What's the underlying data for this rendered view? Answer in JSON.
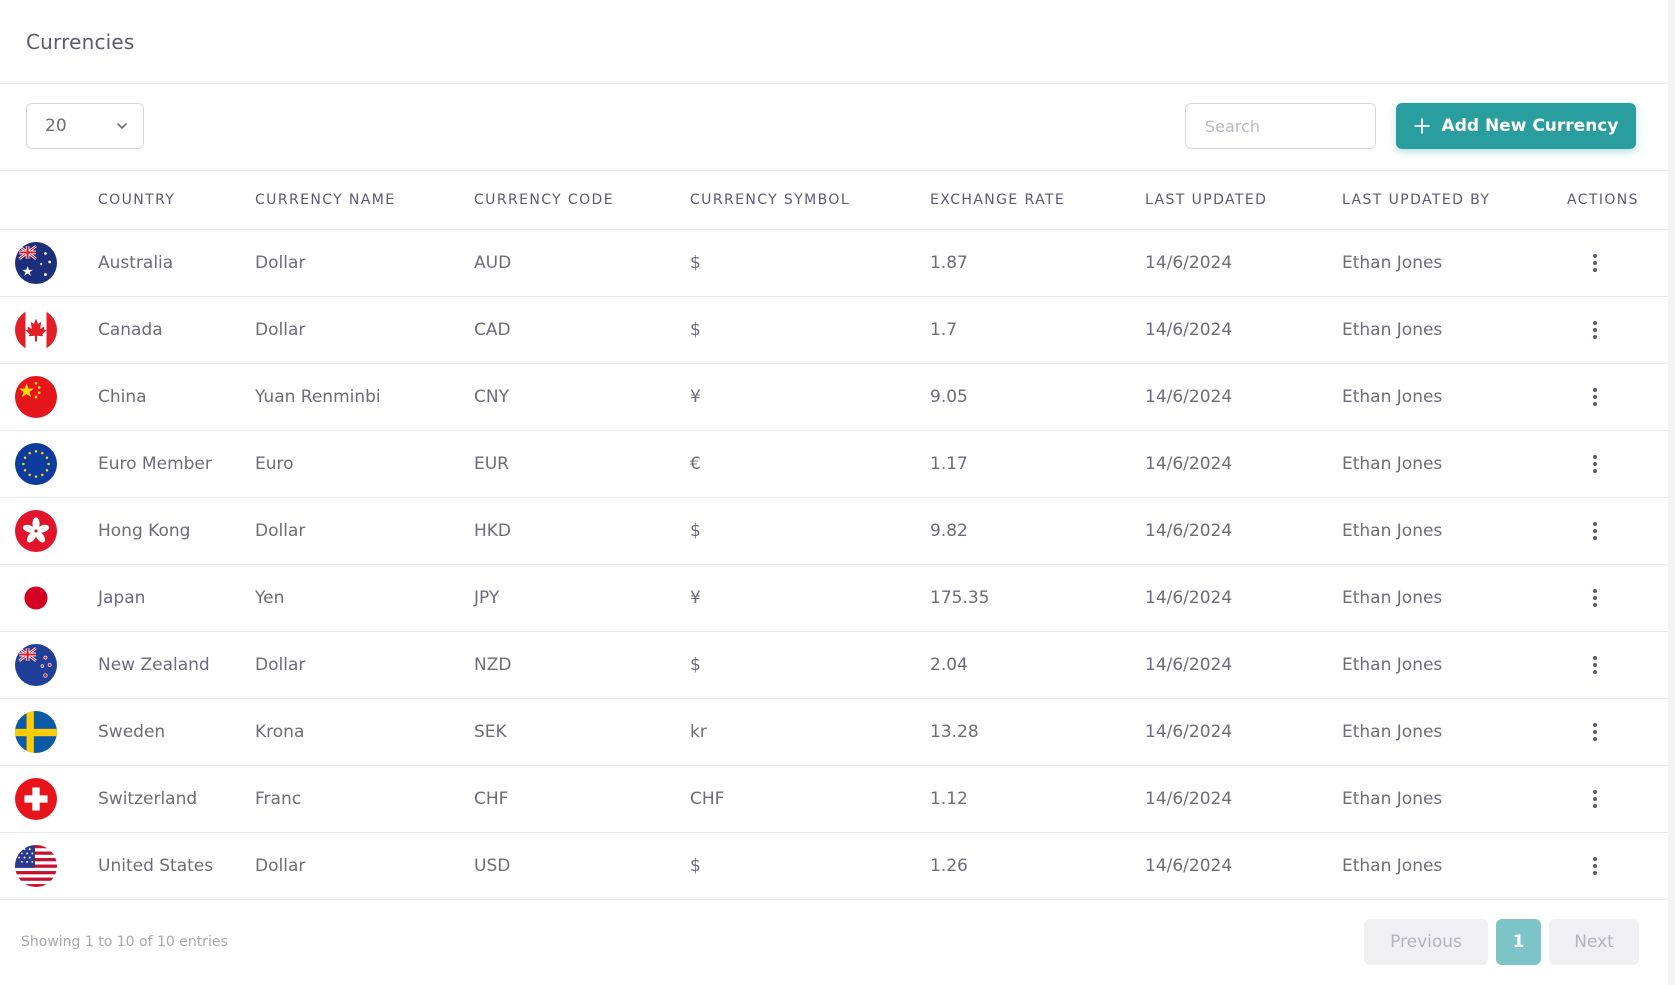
{
  "header": {
    "title": "Currencies"
  },
  "toolbar": {
    "page_length": "20",
    "search_placeholder": "Search",
    "add_label": "Add New Currency"
  },
  "columns": [
    "COUNTRY",
    "CURRENCY NAME",
    "CURRENCY CODE",
    "CURRENCY SYMBOL",
    "EXCHANGE RATE",
    "LAST UPDATED",
    "LAST UPDATED BY",
    "ACTIONS"
  ],
  "rows": [
    {
      "flag": "australia-flag-icon",
      "country": "Australia",
      "name": "Dollar",
      "code": "AUD",
      "symbol": "$",
      "rate": "1.87",
      "updated": "14/6/2024",
      "by": "Ethan Jones"
    },
    {
      "flag": "canada-flag-icon",
      "country": "Canada",
      "name": "Dollar",
      "code": "CAD",
      "symbol": "$",
      "rate": "1.7",
      "updated": "14/6/2024",
      "by": "Ethan Jones"
    },
    {
      "flag": "china-flag-icon",
      "country": "China",
      "name": "Yuan Renminbi",
      "code": "CNY",
      "symbol": "¥",
      "rate": "9.05",
      "updated": "14/6/2024",
      "by": "Ethan Jones"
    },
    {
      "flag": "eu-flag-icon",
      "country": "Euro Member",
      "name": "Euro",
      "code": "EUR",
      "symbol": "€",
      "rate": "1.17",
      "updated": "14/6/2024",
      "by": "Ethan Jones"
    },
    {
      "flag": "hong-kong-flag-icon",
      "country": "Hong Kong",
      "name": "Dollar",
      "code": "HKD",
      "symbol": "$",
      "rate": "9.82",
      "updated": "14/6/2024",
      "by": "Ethan Jones"
    },
    {
      "flag": "japan-flag-icon",
      "country": "Japan",
      "name": "Yen",
      "code": "JPY",
      "symbol": "¥",
      "rate": "175.35",
      "updated": "14/6/2024",
      "by": "Ethan Jones"
    },
    {
      "flag": "new-zealand-flag-icon",
      "country": "New Zealand",
      "name": "Dollar",
      "code": "NZD",
      "symbol": "$",
      "rate": "2.04",
      "updated": "14/6/2024",
      "by": "Ethan Jones"
    },
    {
      "flag": "sweden-flag-icon",
      "country": "Sweden",
      "name": "Krona",
      "code": "SEK",
      "symbol": "kr",
      "rate": "13.28",
      "updated": "14/6/2024",
      "by": "Ethan Jones"
    },
    {
      "flag": "switzerland-flag-icon",
      "country": "Switzerland",
      "name": "Franc",
      "code": "CHF",
      "symbol": "CHF",
      "rate": "1.12",
      "updated": "14/6/2024",
      "by": "Ethan Jones"
    },
    {
      "flag": "usa-flag-icon",
      "country": "United States",
      "name": "Dollar",
      "code": "USD",
      "symbol": "$",
      "rate": "1.26",
      "updated": "14/6/2024",
      "by": "Ethan Jones"
    }
  ],
  "footer": {
    "info": "Showing 1 to 10 of 10 entries",
    "prev_label": "Previous",
    "page_label": "1",
    "next_label": "Next"
  },
  "colors": {
    "primary": "#2a9d9f",
    "active_page": "#7cc4c7",
    "text": "#6e6b7b",
    "border": "#ebe9f1"
  }
}
